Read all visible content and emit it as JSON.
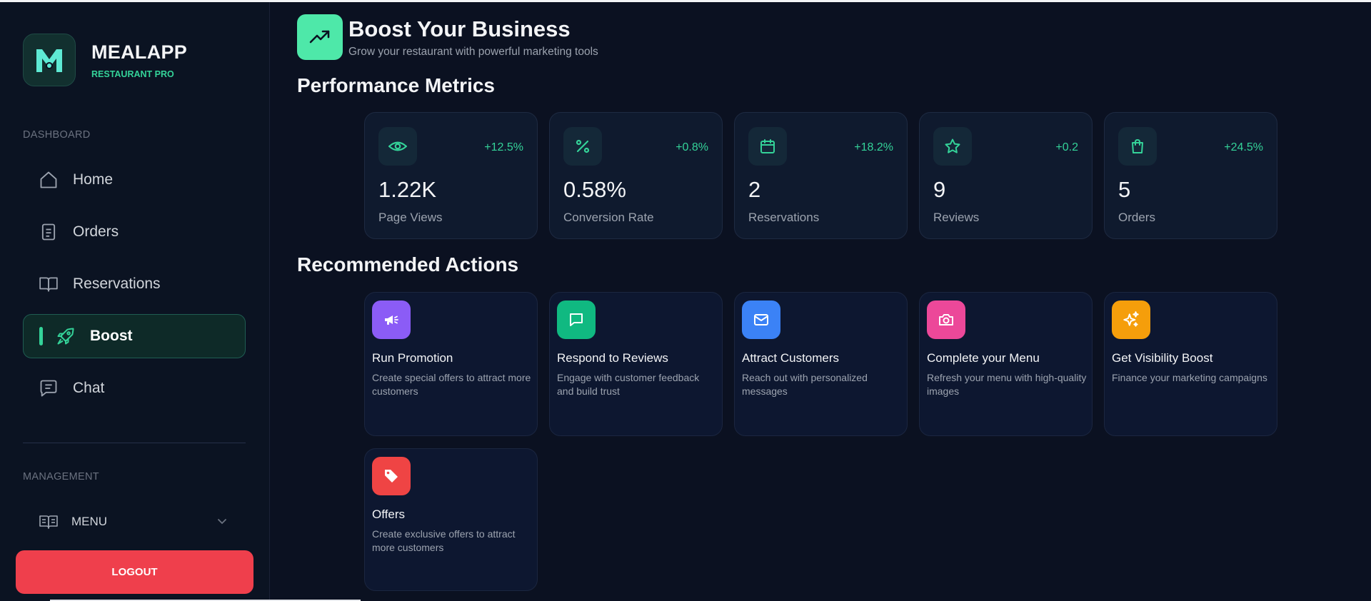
{
  "brand": {
    "name": "MEALAPP",
    "subtitle": "RESTAURANT PRO"
  },
  "sidebar": {
    "dashboard_label": "DASHBOARD",
    "items": [
      {
        "label": "Home",
        "icon": "home-icon"
      },
      {
        "label": "Orders",
        "icon": "document-icon"
      },
      {
        "label": "Reservations",
        "icon": "book-open-icon"
      },
      {
        "label": "Boost",
        "icon": "rocket-icon",
        "active": true
      },
      {
        "label": "Chat",
        "icon": "chat-icon"
      }
    ],
    "management_label": "MANAGEMENT",
    "menu_label": "MENU",
    "logout_label": "LOGOUT"
  },
  "header": {
    "title": "Boost Your Business",
    "subtitle": "Grow your restaurant with powerful marketing tools",
    "icon": "trending-up-icon"
  },
  "metrics": {
    "title": "Performance Metrics",
    "cards": [
      {
        "icon": "eye-icon",
        "change": "+12.5%",
        "value": "1.22K",
        "label": "Page Views"
      },
      {
        "icon": "percent-icon",
        "change": "+0.8%",
        "value": "0.58%",
        "label": "Conversion Rate"
      },
      {
        "icon": "calendar-icon",
        "change": "+18.2%",
        "value": "2",
        "label": "Reservations"
      },
      {
        "icon": "star-icon",
        "change": "+0.2",
        "value": "9",
        "label": "Reviews"
      },
      {
        "icon": "shopping-bag-icon",
        "change": "+24.5%",
        "value": "5",
        "label": "Orders"
      }
    ]
  },
  "actions": {
    "title": "Recommended Actions",
    "cards": [
      {
        "icon": "megaphone-icon",
        "color": "#8b5cf6",
        "title": "Run Promotion",
        "description": "Create special offers to attract more customers"
      },
      {
        "icon": "message-square-icon",
        "color": "#10b981",
        "title": "Respond to Reviews",
        "description": "Engage with customer feedback and build trust"
      },
      {
        "icon": "mail-icon",
        "color": "#3b82f6",
        "title": "Attract Customers",
        "description": "Reach out with personalized messages"
      },
      {
        "icon": "camera-icon",
        "color": "#ec4899",
        "title": "Complete your Menu",
        "description": "Refresh your menu with high-quality images"
      },
      {
        "icon": "sparkles-icon",
        "color": "#f59e0b",
        "title": "Get Visibility Boost",
        "description": "Finance your marketing campaigns"
      },
      {
        "icon": "tag-icon",
        "color": "#ef4444",
        "title": "Offers",
        "description": "Create exclusive offers to attract more customers"
      }
    ]
  },
  "colors": {
    "background": "#0b1121",
    "accent": "#34d399",
    "logout": "#ef3f4c"
  }
}
